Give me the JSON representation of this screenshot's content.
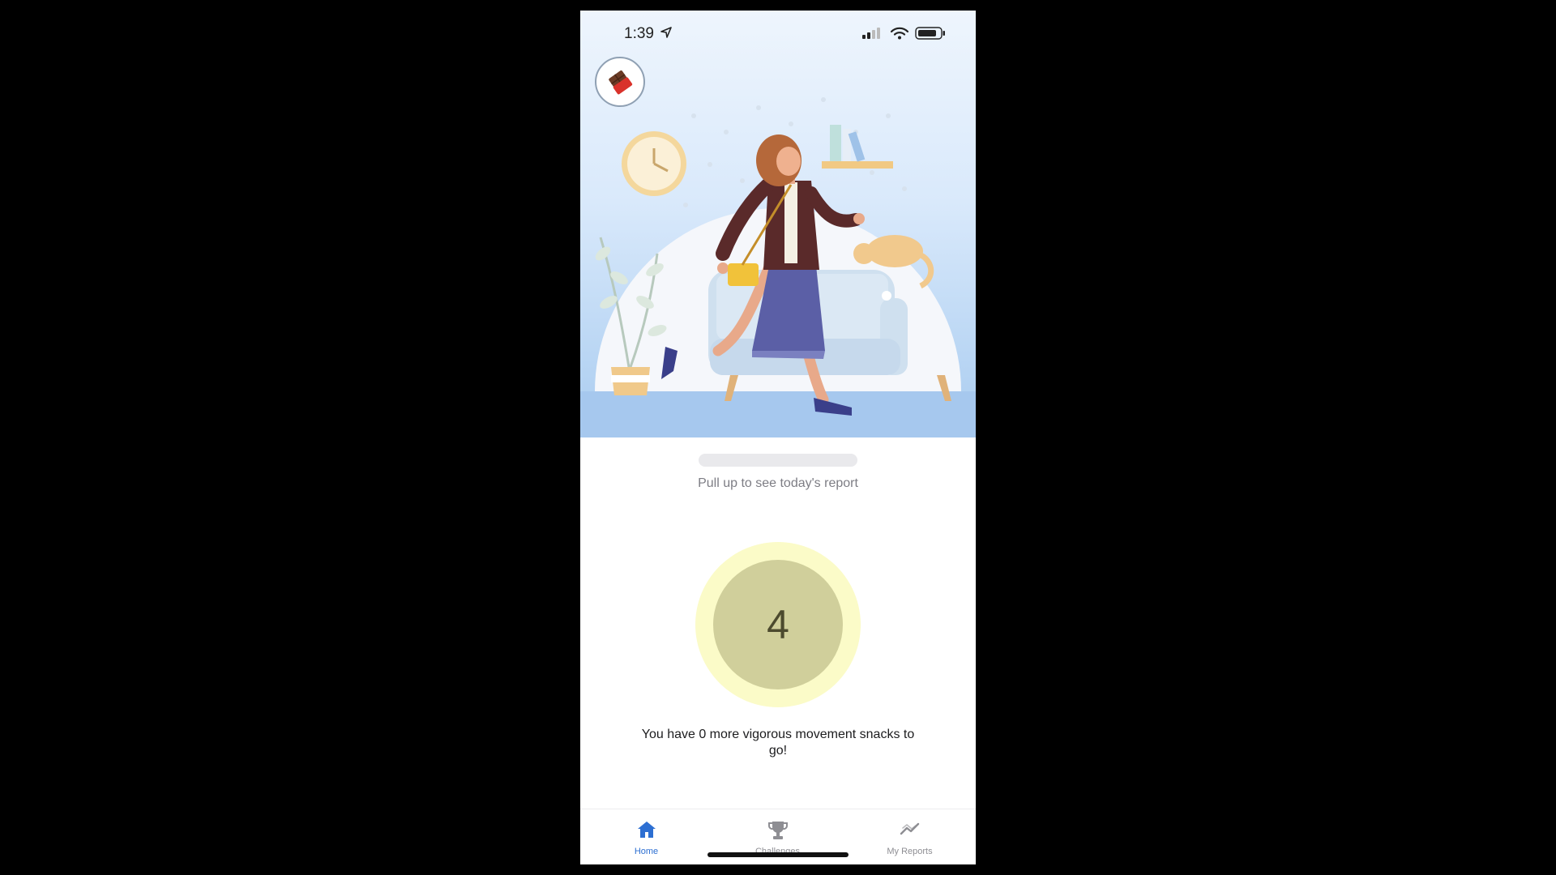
{
  "status_bar": {
    "time": "1:39",
    "icons": [
      "location-arrow-icon",
      "cellular-signal-icon",
      "wifi-icon",
      "battery-icon"
    ]
  },
  "header": {
    "avatar_icon": "chocolate-bar-icon"
  },
  "sheet": {
    "hint": "Pull up to see today's report"
  },
  "counter": {
    "value": "4",
    "message": "You have 0 more vigorous movement snacks to go!"
  },
  "tabs": [
    {
      "label": "Home",
      "icon": "home-icon",
      "active": true
    },
    {
      "label": "Challenges",
      "icon": "trophy-icon",
      "active": false
    },
    {
      "label": "My Reports",
      "icon": "trend-chart-icon",
      "active": false
    }
  ],
  "colors": {
    "accent": "#2d6fd2",
    "ring_outer": "#fbfbc8",
    "ring_inner": "#d0cf9b",
    "hero_bottom": "#a6c8ee"
  }
}
